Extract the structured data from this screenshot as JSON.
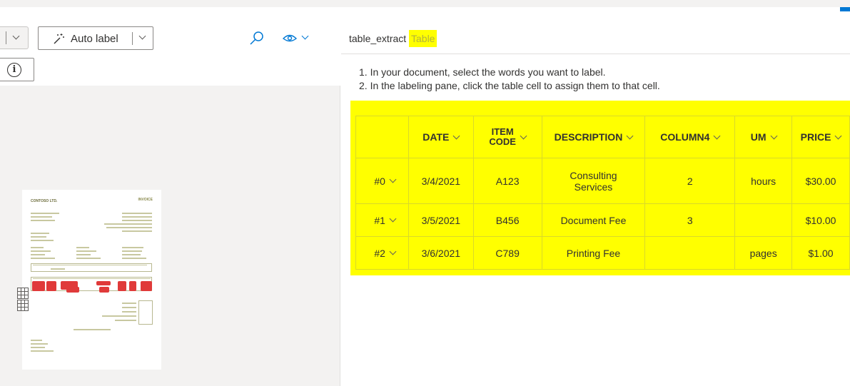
{
  "toolbar": {
    "auto_label": "Auto label"
  },
  "document": {
    "company": "CONTOSO LTD.",
    "title": "INVOICE"
  },
  "field": {
    "name": "table_extract",
    "type": "Table"
  },
  "instructions": [
    "1. In your document, select the words you want to label.",
    "2. In the labeling pane, click the table cell to assign them to that cell."
  ],
  "table": {
    "columns": [
      {
        "label": "DATE"
      },
      {
        "label": "ITEM",
        "label2": "CODE"
      },
      {
        "label": "DESCRIPTION"
      },
      {
        "label": "COLUMN4"
      },
      {
        "label": "UM"
      },
      {
        "label": "PRICE"
      }
    ],
    "rows": [
      {
        "label": "#0",
        "date": "3/4/2021",
        "item_code": "A123",
        "description_l1": "Consulting",
        "description_l2": "Services",
        "column4": "2",
        "um": "hours",
        "price": "$30.00"
      },
      {
        "label": "#1",
        "date": "3/5/2021",
        "item_code": "B456",
        "description_l1": "Document Fee",
        "description_l2": "",
        "column4": "3",
        "um": "",
        "price": "$10.00"
      },
      {
        "label": "#2",
        "date": "3/6/2021",
        "item_code": "C789",
        "description_l1": "Printing Fee",
        "description_l2": "",
        "column4": "",
        "um": "pages",
        "price": "$1.00"
      }
    ]
  },
  "colors": {
    "highlight": "#ffff00",
    "accent": "#0078d4",
    "redaction": "#e03a3a"
  },
  "icons": [
    "chevron-down-icon",
    "magic-wand-icon",
    "search-icon",
    "eye-icon",
    "info-icon",
    "table-icon"
  ]
}
